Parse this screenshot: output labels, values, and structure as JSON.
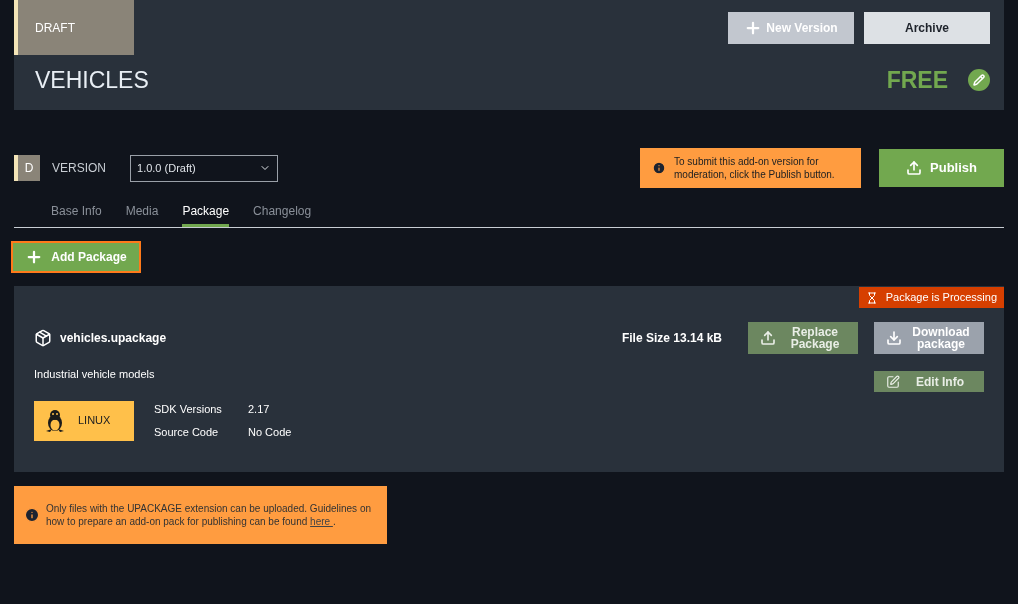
{
  "header": {
    "status_badge": "DRAFT",
    "title": "VEHICLES",
    "price": "FREE",
    "buttons": [
      {
        "label": "New Version",
        "kind": "add"
      },
      {
        "label": "Archive",
        "kind": "plain"
      }
    ]
  },
  "version": {
    "badge": "D",
    "label": "VERSION",
    "select_value": "1.0.0 (Draft)",
    "notice": "To submit this add-on version for moderation, click the Publish button.",
    "publish_button": "Publish"
  },
  "tabs": [
    {
      "label": "Base Info",
      "selected": false
    },
    {
      "label": "Media",
      "selected": false
    },
    {
      "label": "Package",
      "selected": true
    },
    {
      "label": "Changelog",
      "selected": false
    }
  ],
  "add_package_button": "Add Package",
  "package": {
    "status": "Package is Processing",
    "file_name": "vehicles.upackage",
    "file_size": "File Size 13.14 kB",
    "description": "Industrial vehicle models",
    "platform": "LINUX",
    "details": [
      {
        "label": "SDK Versions",
        "value": "2.17"
      },
      {
        "label": "Source Code",
        "value": "No Code"
      }
    ],
    "buttons": [
      {
        "label": "Replace Package",
        "kind": "upload",
        "disabled": false
      },
      {
        "label": "Download package",
        "kind": "download",
        "disabled": true
      }
    ],
    "edit_button": "Edit Info"
  },
  "note": {
    "text": "Only files with the UPACKAGE extension can be uploaded. Guidelines on how to prepare an add-on pack for publishing can be found",
    "link": "here ",
    "end": "."
  }
}
